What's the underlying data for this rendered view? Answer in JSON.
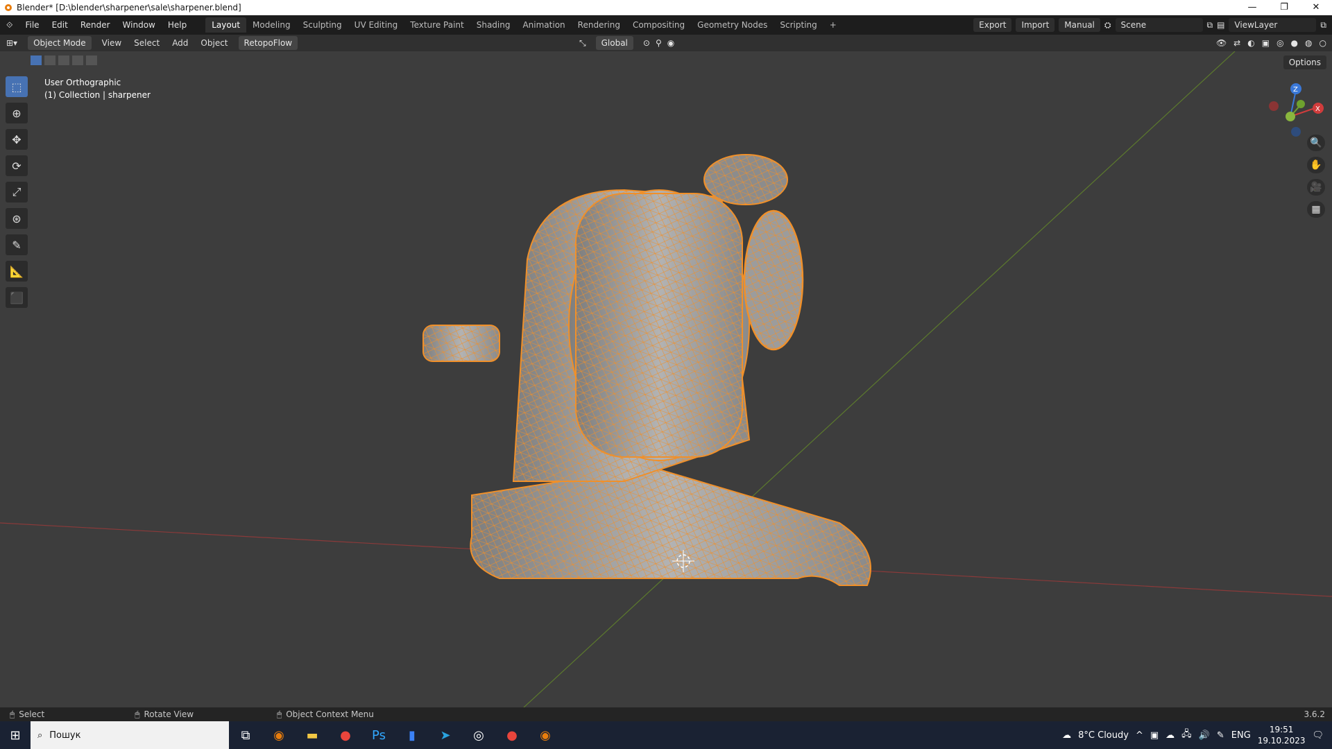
{
  "window": {
    "title": "Blender* [D:\\blender\\sharpener\\sale\\sharpener.blend]"
  },
  "menu": [
    "File",
    "Edit",
    "Render",
    "Window",
    "Help"
  ],
  "workspaces": [
    "Layout",
    "Modeling",
    "Sculpting",
    "UV Editing",
    "Texture Paint",
    "Shading",
    "Animation",
    "Rendering",
    "Compositing",
    "Geometry Nodes",
    "Scripting"
  ],
  "topright": {
    "export": "Export",
    "import": "Import",
    "manual": "Manual",
    "scene": "Scene",
    "viewlayer": "ViewLayer"
  },
  "header": {
    "mode": "Object Mode",
    "view": "View",
    "select": "Select",
    "add": "Add",
    "object": "Object",
    "retopo": "RetopoFlow",
    "orientation": "Global",
    "options": "Options"
  },
  "viewport": {
    "view_name": "User Orthographic",
    "collection": "(1) Collection | sharpener"
  },
  "statusbar": {
    "select": "Select",
    "rotate": "Rotate View",
    "context": "Object Context Menu",
    "version": "3.6.2"
  },
  "taskbar": {
    "search": "Пошук",
    "weather": "8°C  Cloudy",
    "lang": "ENG",
    "time": "19:51",
    "date": "19.10.2023"
  },
  "colors": {
    "accent": "#4772b3",
    "wire": "#f0902a",
    "mesh": "#9a9a9a"
  }
}
